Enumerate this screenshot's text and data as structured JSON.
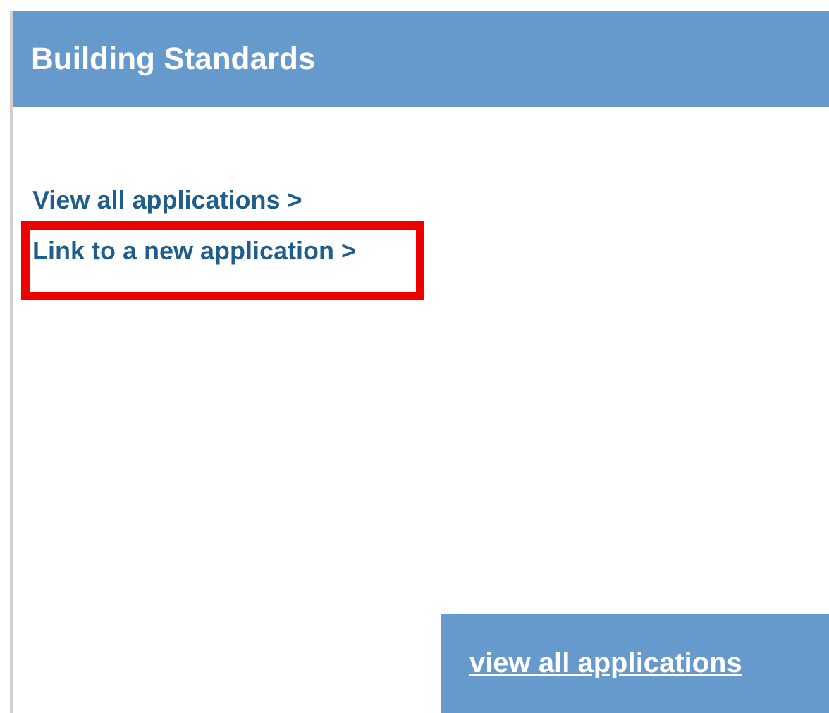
{
  "panel": {
    "title": "Building Standards"
  },
  "links": [
    {
      "label": "View all applications >",
      "highlighted": false
    },
    {
      "label": "Link to a new application >",
      "highlighted": true
    }
  ],
  "footer_button": {
    "label": "view all applications"
  }
}
